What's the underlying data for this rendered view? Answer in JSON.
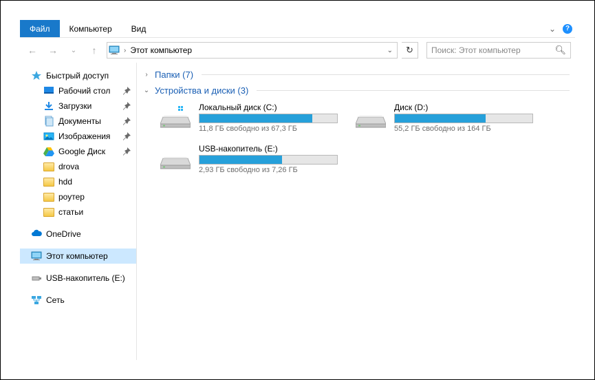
{
  "menu": {
    "file": "Файл",
    "computer": "Компьютер",
    "view": "Вид"
  },
  "address": {
    "location": "Этот компьютер"
  },
  "search": {
    "placeholder": "Поиск: Этот компьютер"
  },
  "sidebar": {
    "quick": "Быстрый доступ",
    "items": [
      {
        "label": "Рабочий стол"
      },
      {
        "label": "Загрузки"
      },
      {
        "label": "Документы"
      },
      {
        "label": "Изображения"
      },
      {
        "label": "Google Диск"
      },
      {
        "label": "drova"
      },
      {
        "label": "hdd"
      },
      {
        "label": "роутер"
      },
      {
        "label": "статьи"
      }
    ],
    "onedrive": "OneDrive",
    "thispc": "Этот компьютер",
    "usb": "USB-накопитель (E:)",
    "network": "Сеть"
  },
  "groups": {
    "folders": {
      "title": "Папки (7)"
    },
    "devices": {
      "title": "Устройства и диски (3)"
    }
  },
  "drives": [
    {
      "name": "Локальный диск (C:)",
      "info": "11,8 ГБ свободно из 67,3 ГБ",
      "used_pct": 82,
      "os": true
    },
    {
      "name": "Диск (D:)",
      "info": "55,2 ГБ свободно из 164 ГБ",
      "used_pct": 66,
      "os": false
    },
    {
      "name": "USB-накопитель (E:)",
      "info": "2,93 ГБ свободно из 7,26 ГБ",
      "used_pct": 60,
      "os": false
    }
  ]
}
